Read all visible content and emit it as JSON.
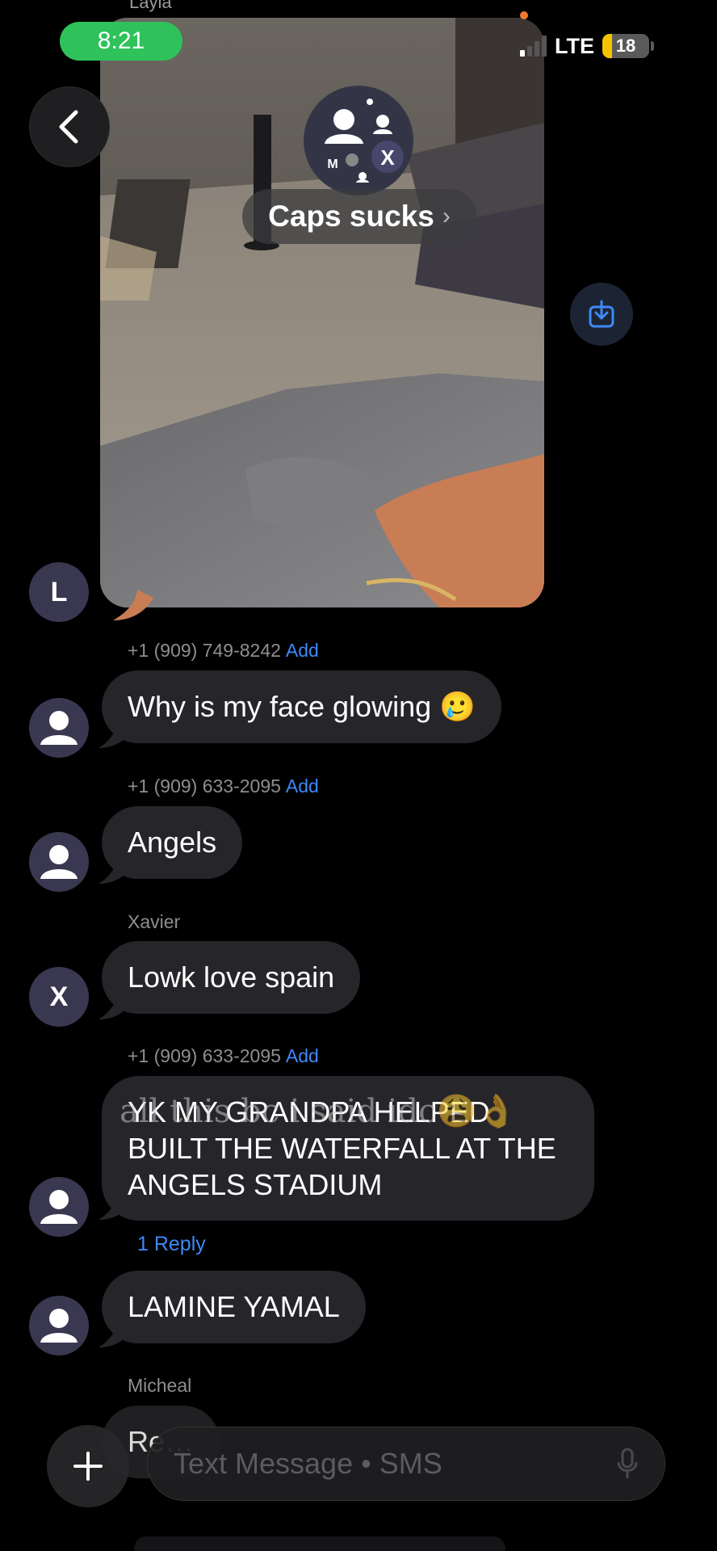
{
  "status_bar": {
    "time": "8:21",
    "network": "LTE",
    "battery": "18"
  },
  "header": {
    "top_sender_name": "Layla",
    "group_name": "Caps sucks",
    "chevron": "›",
    "group_avatar_initials": [
      "M",
      "X"
    ]
  },
  "icons": {
    "back": "chevron-left-icon",
    "download": "download-icon",
    "plus": "plus-icon",
    "mic": "microphone-icon"
  },
  "messages": [
    {
      "avatar": "L",
      "type": "photo"
    },
    {
      "sender": "+1 (909) 749-8242",
      "add": "Add",
      "text": "Why is my face glowing 🥲"
    },
    {
      "sender": "+1 (909) 633-2095",
      "add": "Add",
      "text": "Angels"
    },
    {
      "sender": "Xavier",
      "avatar": "X",
      "text": "Lowk love spain"
    },
    {
      "sender": "+1 (909) 633-2095",
      "add": "Add",
      "text": "YK MY GRANDPA HELPED BUILT THE WATERFALL AT THE ANGELS STADIUM",
      "reply_count": "1 Reply"
    },
    {
      "text": "LAMINE YAMAL"
    },
    {
      "sender": "Micheal",
      "text": "Re…"
    }
  ],
  "overlay_caption": "all this bc i said idc😩👌",
  "composer": {
    "placeholder": "Text Message • SMS"
  },
  "colors": {
    "accent_blue": "#3d8af7",
    "bubble": "#26262a",
    "time_pill": "#2fc25a",
    "avatar": "#3a3850"
  }
}
